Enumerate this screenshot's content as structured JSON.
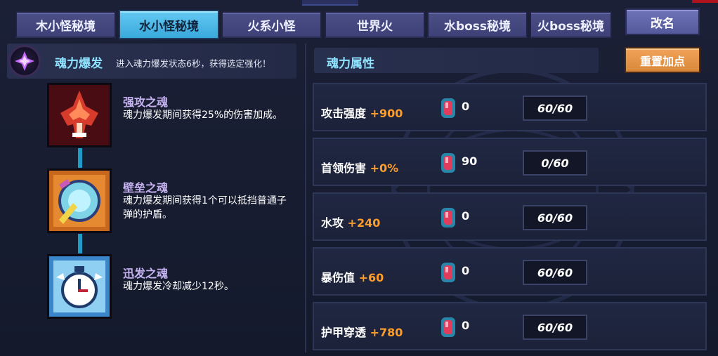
{
  "tabs": [
    {
      "label": "木小怪秘境",
      "active": false
    },
    {
      "label": "水小怪秘境",
      "active": true
    },
    {
      "label": "火系小怪",
      "active": false
    },
    {
      "label": "世界火",
      "active": false
    },
    {
      "label": "水boss秘境",
      "active": false
    },
    {
      "label": "火boss秘境",
      "active": false
    }
  ],
  "rename_label": "改名",
  "soul_burst": {
    "title": "魂力爆发",
    "description": "进入魂力爆发状态6秒，获得选定强化！"
  },
  "souls": [
    {
      "name": "强攻之魂",
      "description": "魂力爆发期间获得25%的伤害加成。",
      "icon": "red-ship-icon"
    },
    {
      "name": "壁垒之魂",
      "description": "魂力爆发期间获得1个可以抵挡普通子弹的护盾。",
      "icon": "shield-orb-icon"
    },
    {
      "name": "迅发之魂",
      "description": "魂力爆发冷却减少12秒。",
      "icon": "clock-icon"
    }
  ],
  "attributes_title": "魂力属性",
  "reset_label": "重置加点",
  "attributes": [
    {
      "name": "攻击强度",
      "bonus": "+900",
      "gems": "0",
      "level": "60/60"
    },
    {
      "name": "首领伤害",
      "bonus": "+0%",
      "gems": "90",
      "level": "0/60"
    },
    {
      "name": "水攻",
      "bonus": "+240",
      "gems": "0",
      "level": "60/60"
    },
    {
      "name": "暴伤值",
      "bonus": "+60",
      "gems": "0",
      "level": "60/60"
    },
    {
      "name": "护甲穿透",
      "bonus": "+780",
      "gems": "0",
      "level": "60/60"
    }
  ],
  "colors": {
    "active_tab": "#4bb8e8",
    "tab": "#434780",
    "accent_cyan": "#8ee3ff",
    "bonus_orange": "#ff9d2a",
    "reset_button": "#e6953f"
  }
}
